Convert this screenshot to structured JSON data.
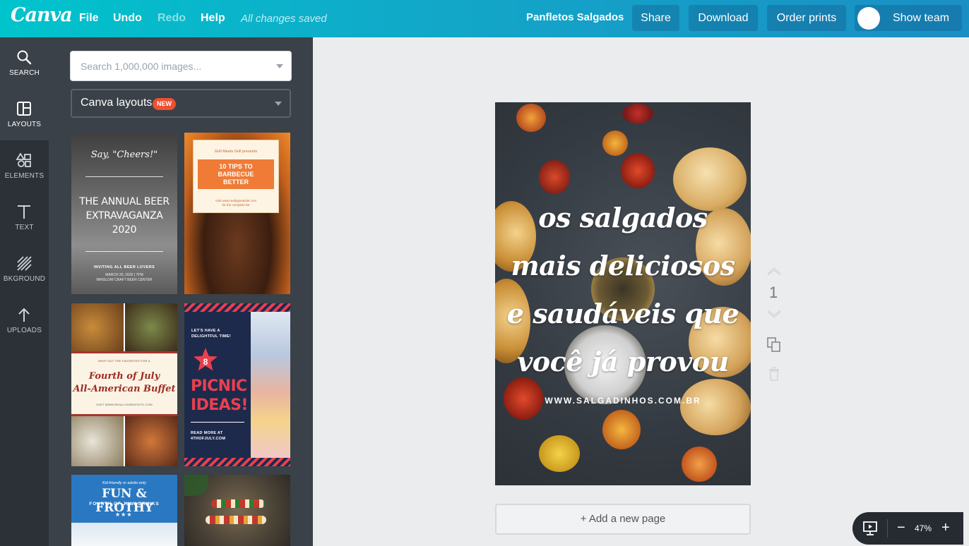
{
  "app": {
    "logo": "Canva"
  },
  "menu": {
    "file": "File",
    "undo": "Undo",
    "redo": "Redo",
    "help": "Help",
    "status": "All changes saved"
  },
  "header": {
    "doc_title": "Panfletos Salgados",
    "share": "Share",
    "download": "Download",
    "order_prints": "Order prints",
    "show_team": "Show team"
  },
  "rail": [
    {
      "label": "SEARCH",
      "icon": "search-icon"
    },
    {
      "label": "LAYOUTS",
      "icon": "layouts-icon"
    },
    {
      "label": "ELEMENTS",
      "icon": "elements-icon"
    },
    {
      "label": "TEXT",
      "icon": "text-icon"
    },
    {
      "label": "BKGROUND",
      "icon": "background-icon"
    },
    {
      "label": "UPLOADS",
      "icon": "uploads-icon"
    }
  ],
  "panel": {
    "search_placeholder": "Search 1,000,000 images...",
    "layouts_label": "Canva layouts",
    "new_badge": "NEW"
  },
  "templates": {
    "beer": {
      "tag": "Say, \"Cheers!\"",
      "title1": "THE ANNUAL BEER",
      "title2": "EXTRAVAGANZA",
      "year": "2020",
      "sub": "INVITING ALL BEER LOVERS",
      "date": "MARCH 20, 2020 | 7PM",
      "venue": "WINSLOW CRAFT BEER CENTER"
    },
    "bbq": {
      "pre": "Grill Meets Grill presents",
      "title1": "10 TIPS TO",
      "title2": "BARBECUE",
      "title3": "BETTER",
      "url": "Visit www.reallygreatsite.com",
      "url2": "for the complete list"
    },
    "buffet": {
      "pre": "WHIP OUT THE FAVORITES FOR A",
      "title1": "Fourth of July",
      "title2": "All-American Buffet",
      "url": "VISIT WWW.REALLYGREATSITE.COM"
    },
    "picnic": {
      "pre1": "LET'S HAVE A",
      "pre2": "DELIGHTFUL TIME!",
      "num": "8",
      "title1": "PICNIC",
      "title2": "IDEAS!",
      "read1": "READ MORE AT",
      "read2": "4THOFJULY.COM"
    },
    "frothy": {
      "pre": "Kid-friendly or adults-only",
      "title": "FUN & FROTHY",
      "sub": "FOURTH OF JULY DRINKS"
    }
  },
  "design": {
    "line1": "os salgados",
    "line2": "mais deliciosos",
    "line3": "e saudáveis que",
    "line4": "você já provou",
    "url": "WWW.SALGADINHOS.COM.BR"
  },
  "page_number": "1",
  "add_page": "+ Add a new page",
  "zoom": {
    "value": "47%",
    "minus": "−",
    "plus": "+"
  },
  "colors": {
    "brand_teal": "#00c4cc",
    "panel": "#3a4148",
    "rail": "#2b3137",
    "badge": "#f04f2f"
  }
}
